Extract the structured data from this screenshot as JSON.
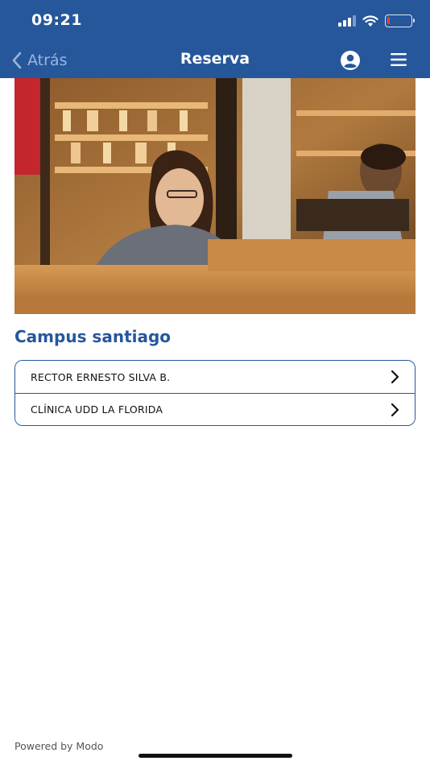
{
  "status_bar": {
    "time": "09:21"
  },
  "nav": {
    "back_label": "Atrás",
    "title": "Reserva"
  },
  "section": {
    "title": "Campus santiago"
  },
  "campus_items": [
    {
      "label": "RECTOR ERNESTO SILVA B."
    },
    {
      "label": "CLÍNICA UDD LA FLORIDA"
    }
  ],
  "footer": {
    "text": "Powered by Modo"
  },
  "colors": {
    "primary": "#26579b",
    "back_link": "#9bb5dd",
    "battery_low": "#ff3b30"
  },
  "icons": [
    "signal-icon",
    "wifi-icon",
    "battery-icon",
    "chevron-left-icon",
    "account-icon",
    "hamburger-menu-icon",
    "chevron-right-icon"
  ]
}
